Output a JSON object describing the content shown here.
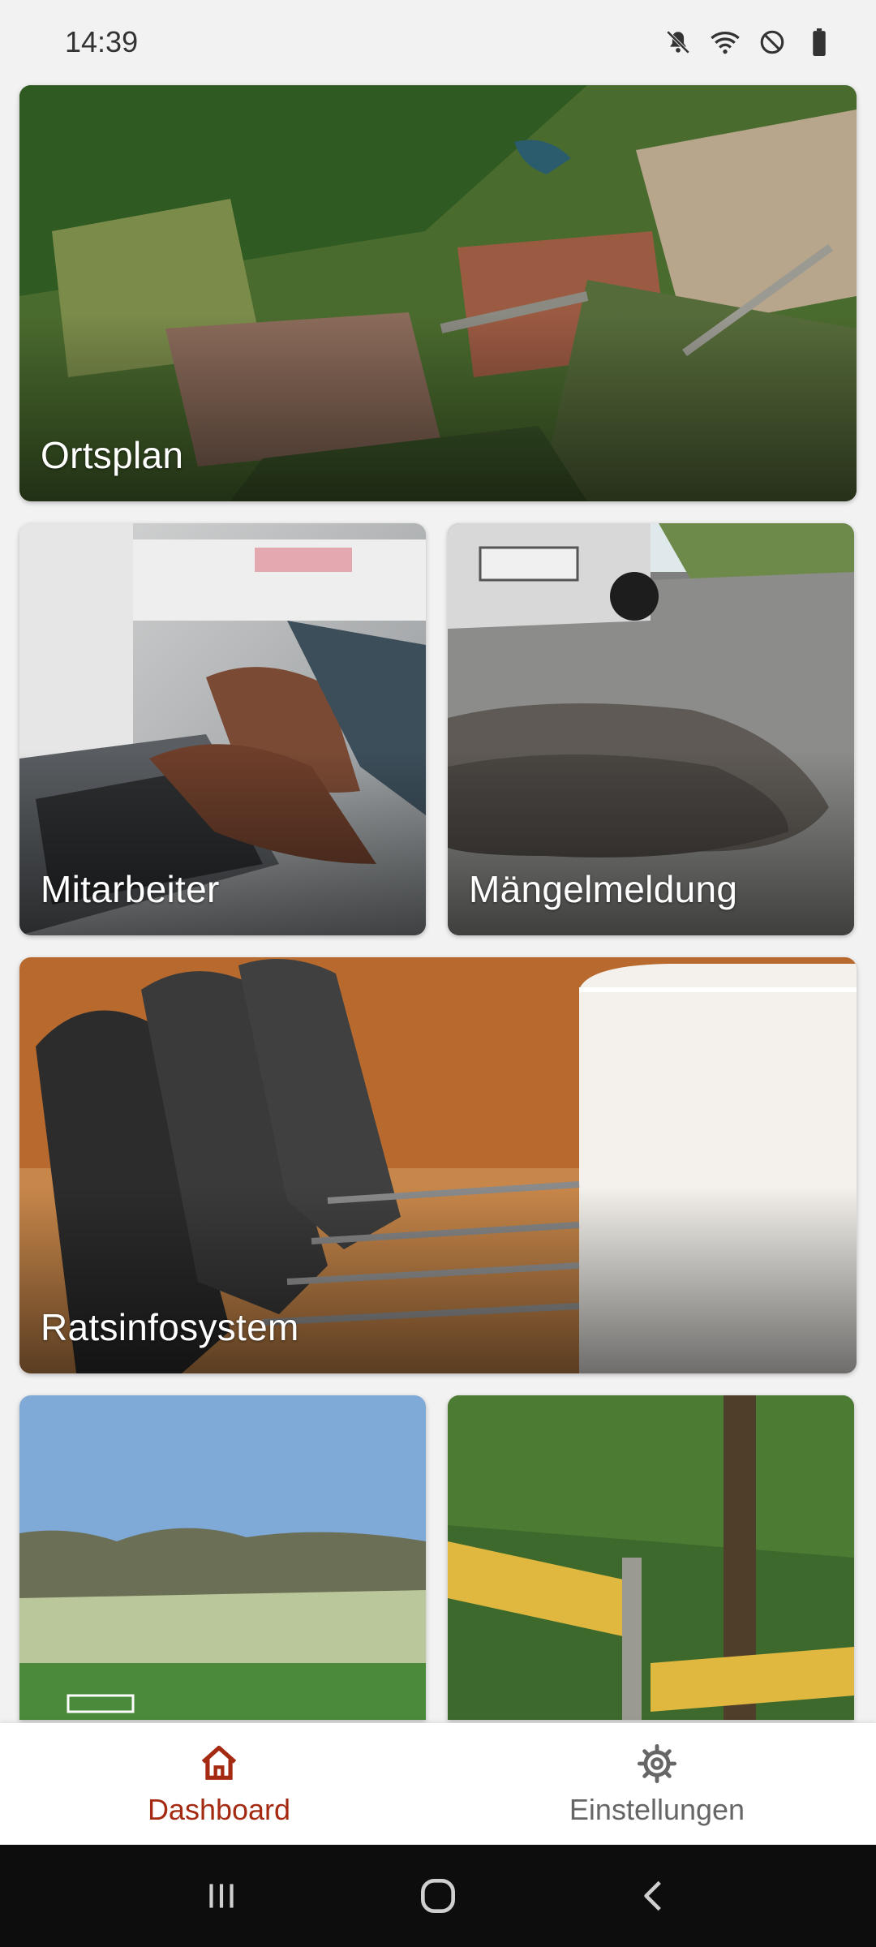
{
  "status_bar": {
    "time": "14:39",
    "icons": [
      "mute-icon",
      "wifi-icon",
      "do-not-disturb-icon",
      "battery-icon"
    ]
  },
  "tiles": [
    {
      "label": "Ortsplan"
    },
    {
      "label": "Mitarbeiter"
    },
    {
      "label": "Mängelmeldung"
    },
    {
      "label": "Ratsinfosystem"
    },
    {
      "label": ""
    },
    {
      "label": ""
    }
  ],
  "bottom_nav": {
    "items": [
      {
        "label": "Dashboard",
        "icon": "home-icon",
        "active": true
      },
      {
        "label": "Einstellungen",
        "icon": "gear-icon",
        "active": false
      }
    ]
  },
  "colors": {
    "accent": "#a52a12",
    "inactive": "#666666",
    "background": "#f2f2f2",
    "system_nav": "#0d0d0d"
  },
  "system_nav": {
    "icons": [
      "recent-apps-icon",
      "home-circle-icon",
      "back-icon"
    ]
  }
}
